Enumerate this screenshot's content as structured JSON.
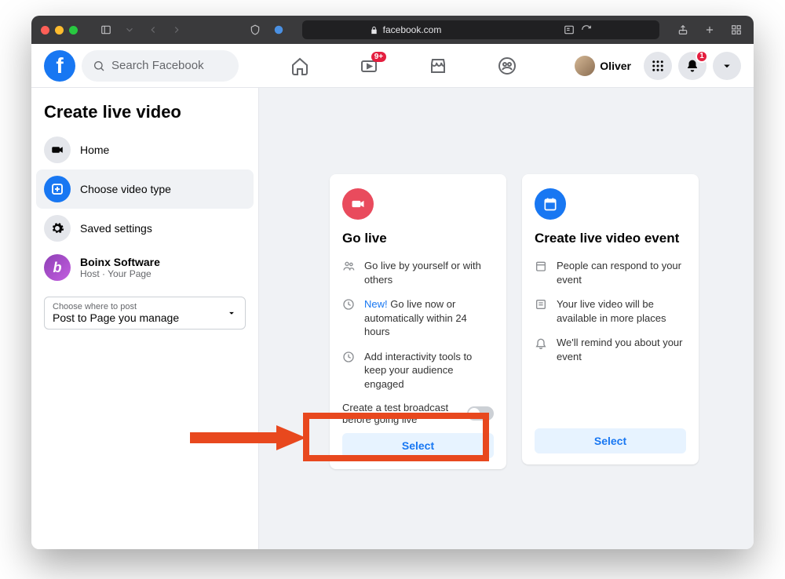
{
  "browser": {
    "url_host": "facebook.com",
    "lock": true
  },
  "fb": {
    "search_placeholder": "Search Facebook",
    "watch_badge": "9+",
    "user_name": "Oliver",
    "notifications_badge": "1"
  },
  "sidebar": {
    "title": "Create live video",
    "items": [
      {
        "label": "Home",
        "icon": "camera",
        "active": false
      },
      {
        "label": "Choose video type",
        "icon": "plus",
        "active": true
      },
      {
        "label": "Saved settings",
        "icon": "gear",
        "active": false
      }
    ],
    "page": {
      "name": "Boinx Software",
      "subtitle": "Host · Your Page"
    },
    "post_selector": {
      "label": "Choose where to post",
      "value": "Post to Page you manage"
    }
  },
  "cards": {
    "go_live": {
      "title": "Go live",
      "bullets": [
        {
          "text": "Go live by yourself or with others",
          "icon": "people"
        },
        {
          "new": "New!",
          "text": "Go live now or automatically within 24 hours",
          "icon": "clock"
        },
        {
          "text": "Add interactivity tools to keep your audience engaged",
          "icon": "clock"
        }
      ],
      "test_label": "Create a test broadcast before going live",
      "select_label": "Select"
    },
    "event": {
      "title": "Create live video event",
      "bullets": [
        {
          "text": "People can respond to your event",
          "icon": "calendar"
        },
        {
          "text": "Your live video will be available in more places",
          "icon": "feed"
        },
        {
          "text": "We'll remind you about your event",
          "icon": "bell"
        }
      ],
      "select_label": "Select"
    }
  }
}
